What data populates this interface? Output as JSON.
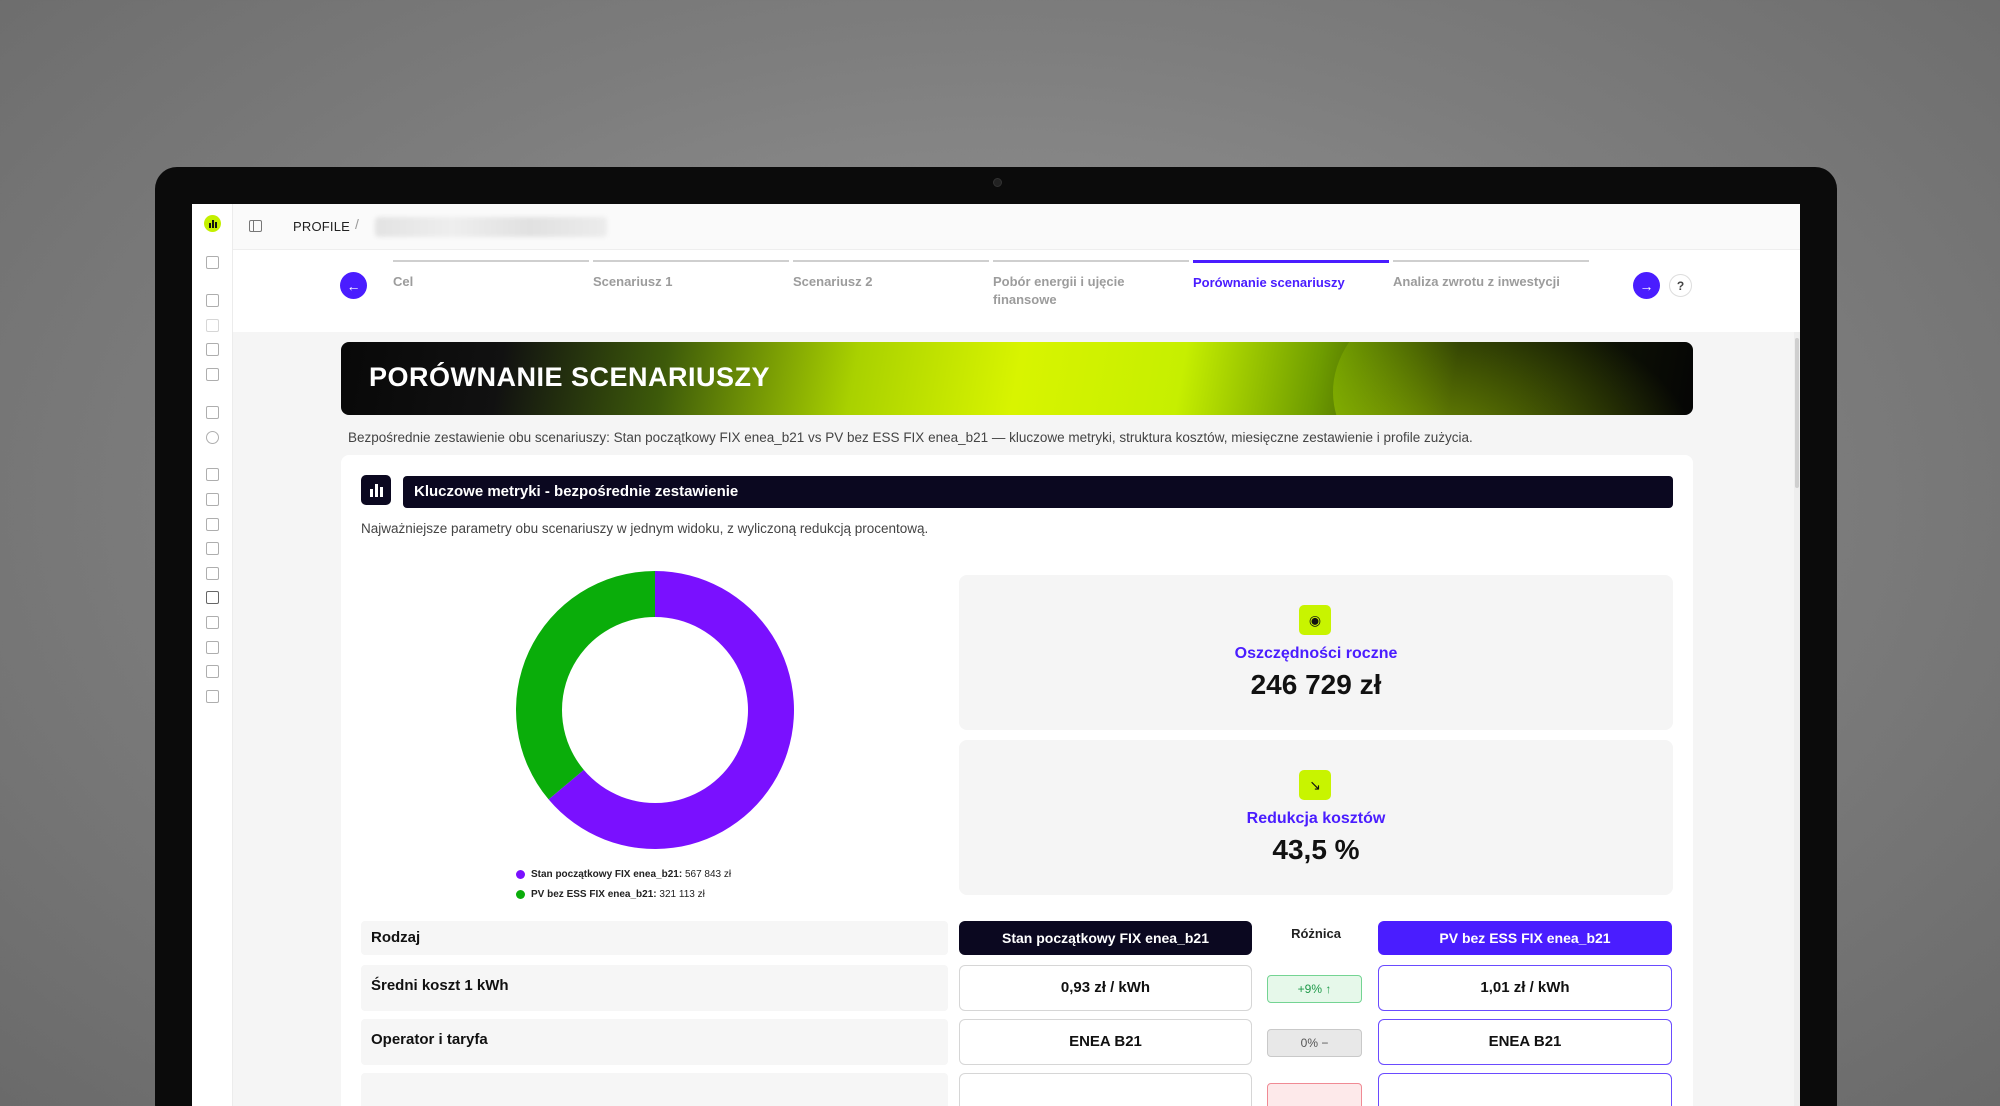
{
  "breadcrumb": {
    "root": "PROFILE",
    "separator": "/"
  },
  "stepper": {
    "prev_icon": "arrow-left-icon",
    "next_icon": "arrow-right-icon",
    "help": "?",
    "steps": [
      {
        "label": "Cel",
        "active": false
      },
      {
        "label": "Scenariusz 1",
        "active": false
      },
      {
        "label": "Scenariusz 2",
        "active": false
      },
      {
        "label": "Pobór energii i ujęcie finansowe",
        "active": false
      },
      {
        "label": "Porównanie scenariuszy",
        "active": true
      },
      {
        "label": "Analiza zwrotu z inwestycji",
        "active": false
      }
    ]
  },
  "page": {
    "title": "PORÓWNANIE SCENARIUSZY",
    "description": "Bezpośrednie zestawienie obu scenariuszy: Stan początkowy FIX enea_b21 vs PV bez ESS FIX enea_b21 — kluczowe metryki, struktura kosztów, miesięczne zestawienie i profile zużycia."
  },
  "section": {
    "title": "Kluczowe metryki - bezpośrednie zestawienie",
    "subtitle": "Najważniejsze parametry obu scenariuszy w jednym widoku, z wyliczoną redukcją procentową."
  },
  "chart_data": {
    "type": "pie",
    "donut": true,
    "categories": [
      "Stan początkowy FIX enea_b21",
      "PV bez ESS FIX enea_b21"
    ],
    "values": [
      567843,
      321113
    ],
    "value_labels": [
      "567 843 zł",
      "321 113 zł"
    ],
    "colors": [
      "#7a10ff",
      "#0aad0a"
    ],
    "legend_position": "bottom"
  },
  "kpis": [
    {
      "icon": "piggy-bank-icon",
      "label": "Oszczędności roczne",
      "value": "246 729 zł"
    },
    {
      "icon": "trending-down-icon",
      "label": "Redukcja kosztów",
      "value": "43,5 %"
    }
  ],
  "table": {
    "col_label": "Rodzaj",
    "col_left": "Stan początkowy FIX enea_b21",
    "col_diff": "Różnica",
    "col_right": "PV bez ESS FIX enea_b21",
    "rows": [
      {
        "label": "Średni koszt 1 kWh",
        "left": "0,93 zł / kWh",
        "diff": "+9% ↑",
        "right": "1,01 zł / kWh"
      },
      {
        "label": "Operator i taryfa",
        "left": "ENEA B21",
        "diff": "0% −",
        "right": "ENEA B21"
      }
    ]
  },
  "colors": {
    "accent": "#4a1dff",
    "brand": "#c8f400",
    "dark": "#0b0820"
  }
}
